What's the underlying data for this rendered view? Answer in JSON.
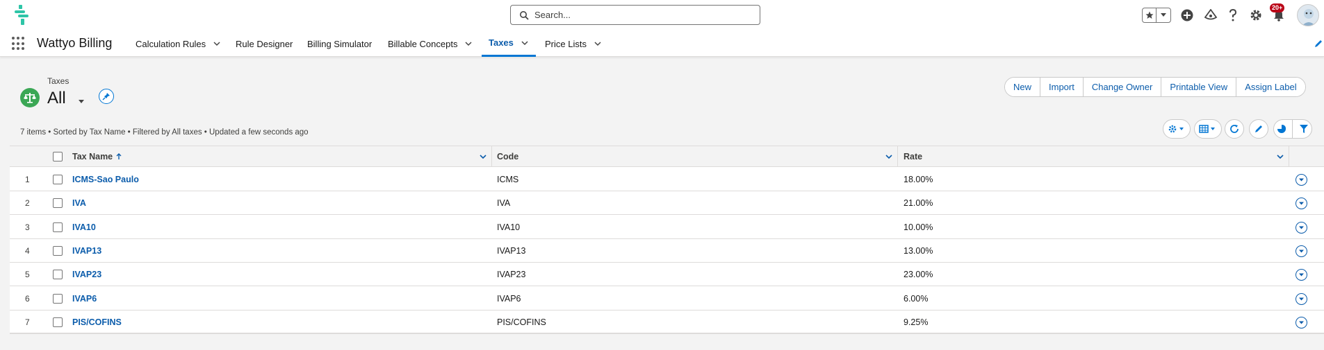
{
  "header": {
    "search_placeholder": "Search...",
    "notification_badge": "20+",
    "logo_color": "#2ec5a7"
  },
  "nav": {
    "app_name": "Wattyo Billing",
    "tabs": [
      {
        "label": "Calculation Rules",
        "has_menu": true,
        "active": false
      },
      {
        "label": "Rule Designer",
        "has_menu": false,
        "active": false
      },
      {
        "label": "Billing Simulator",
        "has_menu": false,
        "active": false
      },
      {
        "label": "Billable Concepts",
        "has_menu": true,
        "active": false
      },
      {
        "label": "Taxes",
        "has_menu": true,
        "active": true
      },
      {
        "label": "Price Lists",
        "has_menu": true,
        "active": false
      }
    ]
  },
  "page": {
    "object_type": "Taxes",
    "list_view": "All",
    "actions": [
      "New",
      "Import",
      "Change Owner",
      "Printable View",
      "Assign Label"
    ],
    "meta": "7 items • Sorted by Tax Name • Filtered by All taxes • Updated a few seconds ago"
  },
  "table": {
    "columns": [
      "Tax Name",
      "Code",
      "Rate"
    ],
    "rows": [
      {
        "num": "1",
        "name": "ICMS-Sao Paulo",
        "code": "ICMS",
        "rate": "18.00%"
      },
      {
        "num": "2",
        "name": "IVA",
        "code": "IVA",
        "rate": "21.00%"
      },
      {
        "num": "3",
        "name": "IVA10",
        "code": "IVA10",
        "rate": "10.00%"
      },
      {
        "num": "4",
        "name": "IVAP13",
        "code": "IVAP13",
        "rate": "13.00%"
      },
      {
        "num": "5",
        "name": "IVAP23",
        "code": "IVAP23",
        "rate": "23.00%"
      },
      {
        "num": "6",
        "name": "IVAP6",
        "code": "IVAP6",
        "rate": "6.00%"
      },
      {
        "num": "7",
        "name": "PIS/COFINS",
        "code": "PIS/COFINS",
        "rate": "9.25%"
      }
    ]
  },
  "colors": {
    "accent": "#0176d3",
    "link": "#0b5cab",
    "object_icon": "#3ba755",
    "badge": "#ba0517"
  }
}
